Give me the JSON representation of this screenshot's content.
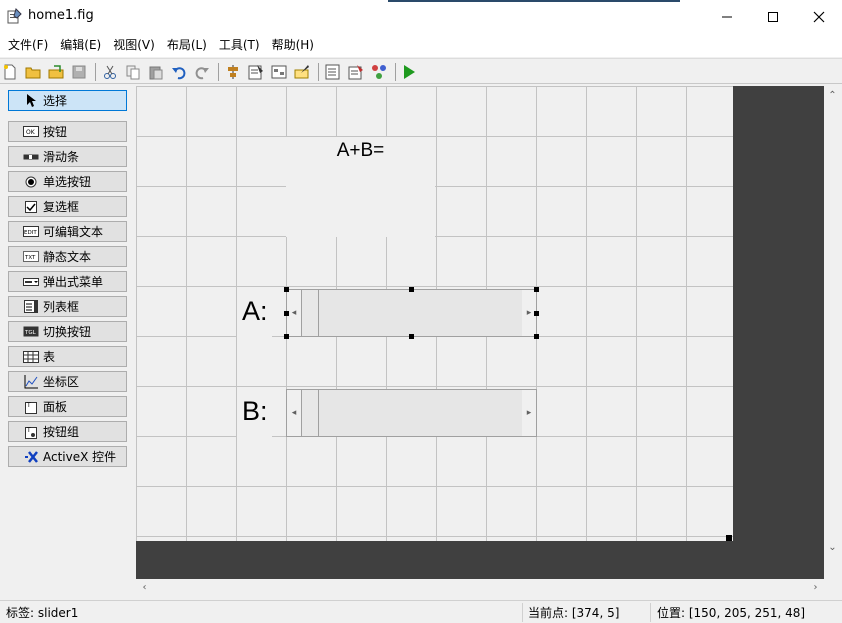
{
  "window": {
    "title": "home1.fig"
  },
  "menu": [
    "文件(F)",
    "编辑(E)",
    "视图(V)",
    "布局(L)",
    "工具(T)",
    "帮助(H)"
  ],
  "toolbar": {
    "buttons": [
      "new-icon",
      "open-icon",
      "save-icon",
      "save-disabled-icon",
      "cut-icon",
      "copy-icon",
      "paste-icon",
      "undo-icon",
      "redo-icon",
      "align-icon",
      "menu-editor-icon",
      "tab-order-icon",
      "toolbar-editor-icon",
      "editor-icon",
      "property-inspector-icon",
      "object-browser-icon",
      "run-icon"
    ]
  },
  "palette": {
    "items": [
      {
        "label": "选择",
        "icon": "cursor-icon",
        "selected": true
      },
      {
        "label": "按钮",
        "icon": "push-button-icon"
      },
      {
        "label": "滑动条",
        "icon": "slider-icon"
      },
      {
        "label": "单选按钮",
        "icon": "radio-icon"
      },
      {
        "label": "复选框",
        "icon": "checkbox-icon"
      },
      {
        "label": "可编辑文本",
        "icon": "edit-text-icon"
      },
      {
        "label": "静态文本",
        "icon": "static-text-icon"
      },
      {
        "label": "弹出式菜单",
        "icon": "popup-menu-icon"
      },
      {
        "label": "列表框",
        "icon": "listbox-icon"
      },
      {
        "label": "切换按钮",
        "icon": "toggle-button-icon"
      },
      {
        "label": "表",
        "icon": "table-icon"
      },
      {
        "label": "坐标区",
        "icon": "axes-icon"
      },
      {
        "label": "面板",
        "icon": "panel-icon"
      },
      {
        "label": "按钮组",
        "icon": "button-group-icon"
      },
      {
        "label": "ActiveX 控件",
        "icon": "activex-icon"
      }
    ]
  },
  "canvas": {
    "sum_label": "A+B=",
    "a_label": "A:",
    "b_label": "B:",
    "slider_a": {
      "name": "slider1",
      "selected": true
    },
    "slider_b": {
      "selected": false
    }
  },
  "status": {
    "tag": "标签: slider1",
    "current_point": "当前点:  [374, 5]",
    "position": "位置: [150, 205, 251, 48]"
  },
  "colors": {
    "canvas_background": "#404040",
    "selection": "#0078d7",
    "run": "#1f9a1f"
  }
}
